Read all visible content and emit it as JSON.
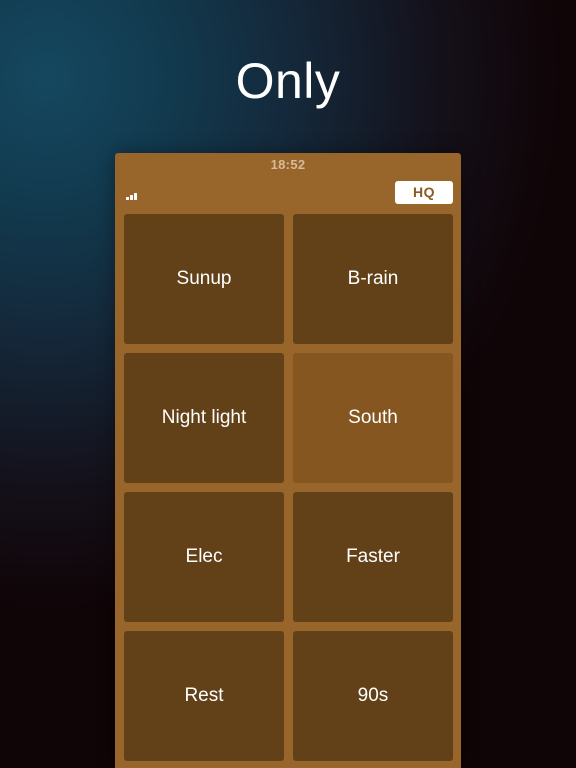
{
  "hero": {
    "title": "Only"
  },
  "status_bar": {
    "time": "18:52"
  },
  "toolbar": {
    "quality_label": "HQ",
    "signal_icon": "signal-bars-icon"
  },
  "sounds": [
    {
      "label": "Sunup",
      "active": false
    },
    {
      "label": "B-rain",
      "active": false
    },
    {
      "label": "Night light",
      "active": false
    },
    {
      "label": "South",
      "active": true
    },
    {
      "label": "Elec",
      "active": false
    },
    {
      "label": "Faster",
      "active": false
    },
    {
      "label": "Rest",
      "active": false
    },
    {
      "label": "90s",
      "active": false
    }
  ],
  "colors": {
    "device_bg": "#98652a",
    "tile_bg": "#624119",
    "tile_active_bg": "#85561f",
    "text": "#ffffff"
  }
}
